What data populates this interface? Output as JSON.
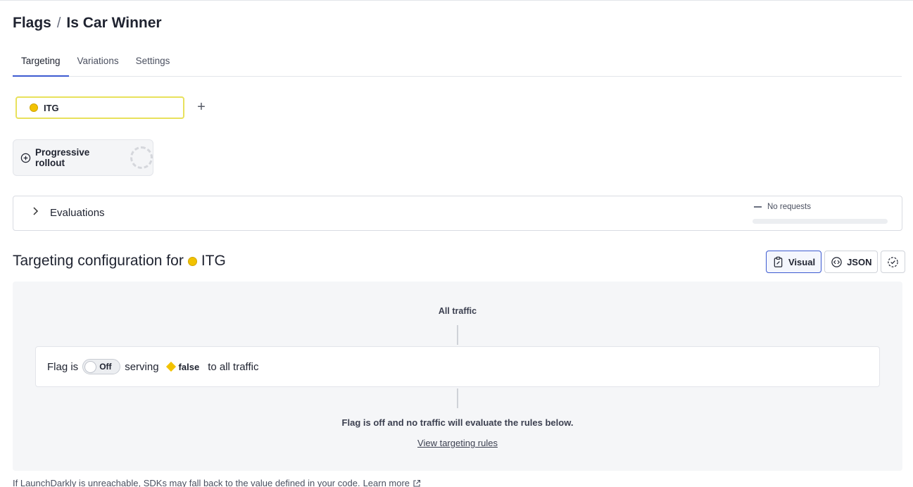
{
  "breadcrumb": {
    "root": "Flags",
    "separator": "/",
    "current": "Is Car Winner"
  },
  "tabs": [
    {
      "label": "Targeting",
      "active": true
    },
    {
      "label": "Variations",
      "active": false
    },
    {
      "label": "Settings",
      "active": false
    }
  ],
  "environment": {
    "name": "ITG",
    "color": "#f2c200"
  },
  "add_environment_symbol": "+",
  "rollout": {
    "label": "Progressive rollout"
  },
  "evaluations": {
    "title": "Evaluations",
    "status": "No requests"
  },
  "targeting": {
    "title_prefix": "Targeting configuration for",
    "env_name": "ITG",
    "view_buttons": {
      "visual": "Visual",
      "json": "JSON"
    },
    "all_traffic": "All traffic",
    "flag_is": "Flag is",
    "toggle_state": "Off",
    "serving": "serving",
    "variation": "false",
    "to_all": "to all traffic",
    "off_message": "Flag is off and no traffic will evaluate the rules below.",
    "view_rules": "View targeting rules"
  },
  "footer": {
    "note": "If LaunchDarkly is unreachable, SDKs may fall back to the value defined in your code.",
    "learn_more": "Learn more"
  },
  "colors": {
    "accent": "#3d5bd1",
    "env_yellow": "#f2c200"
  }
}
